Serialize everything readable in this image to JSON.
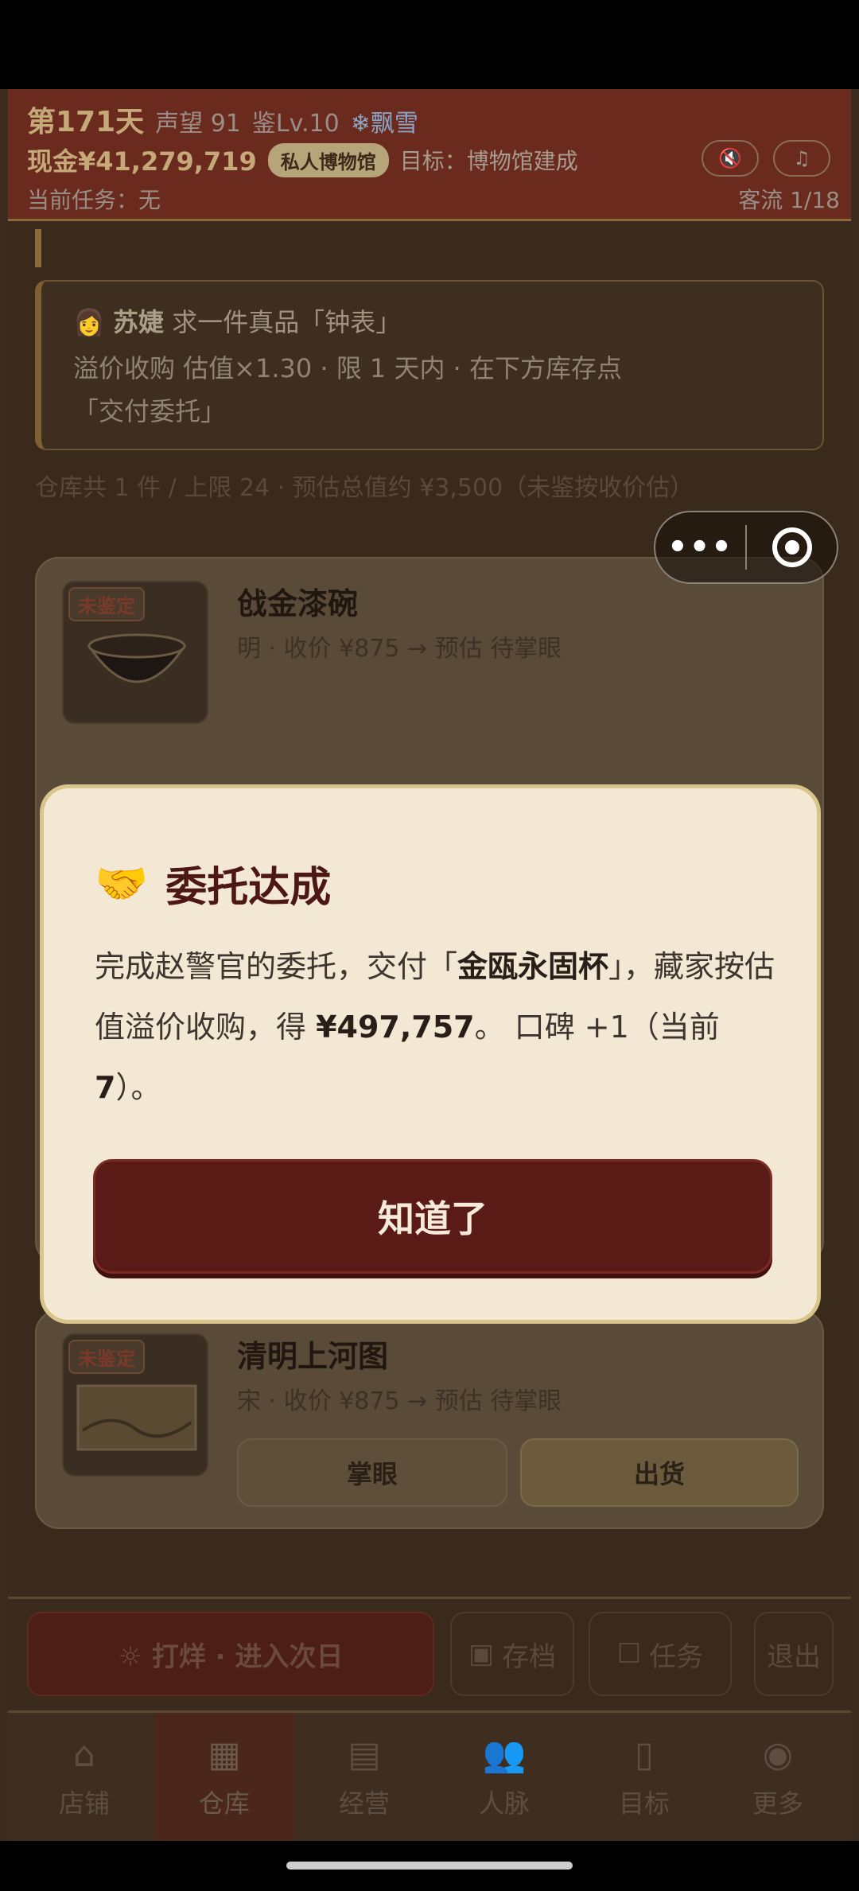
{
  "header": {
    "day": "第171天",
    "reputation": "声望 91",
    "appraisal_level": "鉴Lv.10",
    "weather": "❄飘雪",
    "cash": "现金¥41,279,719",
    "museum_badge": "私人博物馆",
    "goal": "目标：博物馆建成",
    "current_task": "当前任务：无",
    "visitors": "客流 1/18",
    "sound_icon": "speaker-muted-icon",
    "music_icon": "music-note-icon"
  },
  "commission": {
    "client": "苏婕",
    "request": "求一件真品「钟表」",
    "line2": "溢价收购 估值×1.30 · 限 1 天内 · 在下方库存点",
    "line3": "「交付委托」"
  },
  "warehouse_info": "仓库共 1 件 / 上限 24 · 预估总值约 ¥3,500（未鉴按收价估）",
  "items": [
    {
      "badge": "未鉴定",
      "name": "戗金漆碗",
      "meta": "明 · 收价 ¥875 → 预估 待掌眼"
    },
    {
      "badge": "未鉴定",
      "name": "清明上河图",
      "meta": "宋 · 收价 ¥875 → 预估 待掌眼",
      "btn_appraise": "掌眼",
      "btn_ship": "出货"
    }
  ],
  "actions": {
    "next_day": "☼ 打烊 · 进入次日",
    "save": "存档",
    "tasks": "任务",
    "exit": "退出"
  },
  "tabs": [
    {
      "label": "店铺",
      "icon": "shop-icon"
    },
    {
      "label": "仓库",
      "icon": "warehouse-icon"
    },
    {
      "label": "经营",
      "icon": "abacus-icon"
    },
    {
      "label": "人脉",
      "icon": "people-icon"
    },
    {
      "label": "目标",
      "icon": "scroll-icon"
    },
    {
      "label": "更多",
      "icon": "more-icon"
    }
  ],
  "active_tab": "仓库",
  "dialog": {
    "title": "委托达成",
    "body_1": "完成赵警官的委托，交付「",
    "item": "金瓯永固杯",
    "body_2": "」，藏家按估值溢价收购，得 ",
    "amount": "¥497,757",
    "body_3": "。 口碑 +1（当前 ",
    "current": "7",
    "body_4": "）。",
    "button": "知道了"
  },
  "capsule": {
    "more": "•••"
  }
}
